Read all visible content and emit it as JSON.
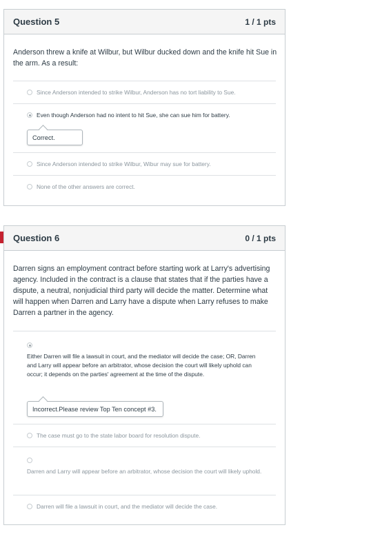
{
  "q5": {
    "title": "Question 5",
    "points": "1 / 1 pts",
    "text": "Anderson threw a knife at Wilbur, but Wilbur ducked down and the knife hit Sue in the arm. As a result:",
    "answers": [
      "Since Anderson intended to strike Wilbur, Anderson has no tort liability to Sue.",
      "Even though Anderson had no intent to hit Sue, she can sue him for battery.",
      "Since Anderson intended to strike Wilbur, Wibur may sue for battery.",
      "None of the other answers are correct."
    ],
    "feedback": "Correct."
  },
  "q6": {
    "title": "Question 6",
    "points": "0 / 1 pts",
    "text": "Darren signs an employment contract before starting work at Larry's advertising agency. Included in the contract is a clause that states that if the parties have a dispute, a neutral, nonjudicial third party will decide the matter. Determine what will happen when Darren and Larry have a dispute when Larry refuses to make Darren a partner in the agency.",
    "answers": [
      "Either Darren will file a lawsuit in court, and the mediator will decide the case; OR, Darren and Larry will appear before an arbitrator, whose decision the court will likely uphold can occur; it depends on the parties' agreement at the time of the dispute.",
      "The case must go to the state labor board for resolution dispute.",
      "Darren and Larry will appear before an arbitrator, whose decision the court will likely uphold.",
      "Darren will file a lawsuit in court, and the mediator will decide the case."
    ],
    "feedback": "Incorrect.Please review Top Ten concept #3."
  },
  "colors": {
    "flag": "#c5222f",
    "header_bg": "#f5f5f5",
    "border": "#c7cdd1",
    "text": "#2d3b45",
    "muted_text": "#8b969e"
  }
}
